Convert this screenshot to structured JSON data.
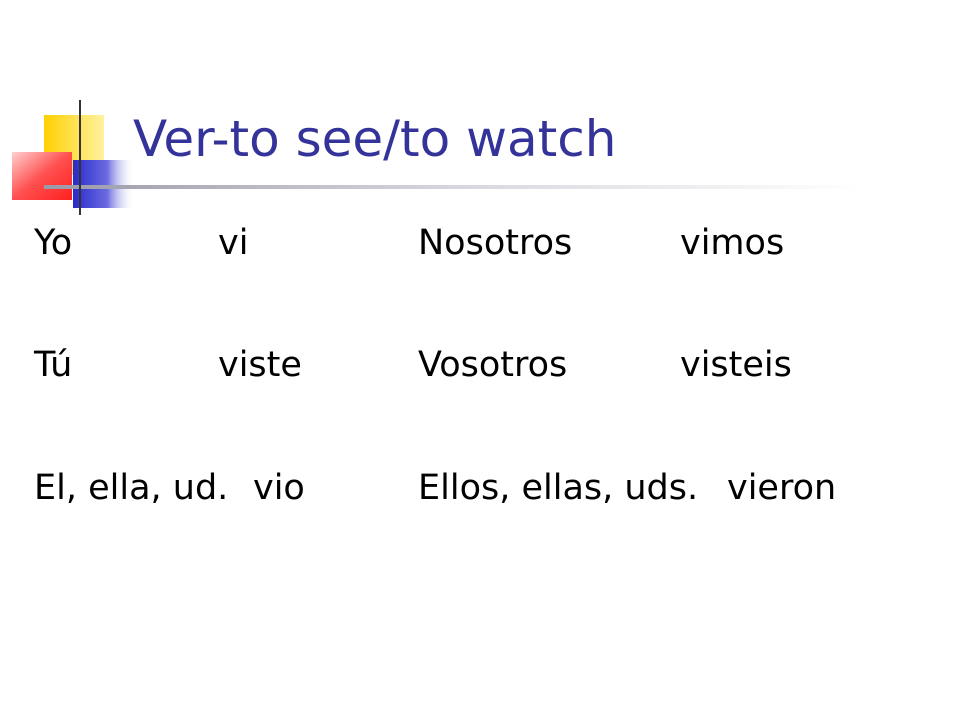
{
  "slide": {
    "title": "Ver-to see/to watch",
    "accent_colors": {
      "title": "#333399",
      "yellow": "#FFD700",
      "blue": "#3333CC",
      "red": "#FF3333"
    },
    "decoration_icon": "overlapping-colored-squares",
    "conjugation": [
      {
        "subject": "Yo",
        "form": "vi",
        "plural_subject": "Nosotros",
        "plural_form": "vimos"
      },
      {
        "subject": "Tú",
        "form": "viste",
        "plural_subject": "Vosotros",
        "plural_form": "visteis"
      },
      {
        "subject": "El, ella, ud.",
        "form": "vio",
        "plural_subject": "Ellos, ellas, uds.",
        "plural_form": "vieron"
      }
    ]
  }
}
